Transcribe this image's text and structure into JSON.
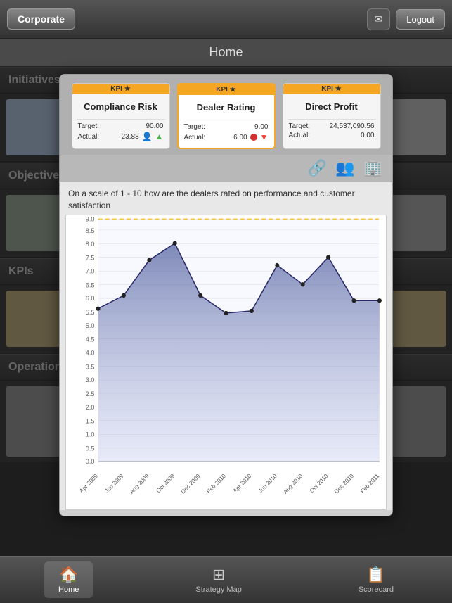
{
  "topBar": {
    "corpLabel": "Corporate",
    "mailIcon": "✉",
    "logoutLabel": "Logout"
  },
  "pageTitle": "Home",
  "sections": {
    "initiatives": "Initiatives",
    "objectives": "Objectives",
    "kpis": "KPIs",
    "operations": "Operations"
  },
  "modal": {
    "kpiCards": [
      {
        "id": "compliance",
        "header": "KPI ★",
        "title": "Compliance Risk",
        "targetLabel": "Target:",
        "targetValue": "90.00",
        "actualLabel": "Actual:",
        "actualValue": "23.88",
        "active": false
      },
      {
        "id": "dealer",
        "header": "KPI ★",
        "title": "Dealer Rating",
        "targetLabel": "Target:",
        "targetValue": "9.00",
        "actualLabel": "Actual:",
        "actualValue": "6.00",
        "active": true
      },
      {
        "id": "profit",
        "header": "KPI ★",
        "title": "Direct Profit",
        "targetLabel": "Target:",
        "targetValue": "24,537,090.56",
        "actualLabel": "Actual:",
        "actualValue": "0.00",
        "active": false
      }
    ],
    "icons": [
      "🔗",
      "👥",
      "🏢"
    ],
    "chartDescription": "On a scale of 1 - 10 how are the dealers rated on performance and customer satisfaction",
    "chart": {
      "targetLine": 9.0,
      "yMax": 9.0,
      "yMin": 0.0,
      "xLabels": [
        "Apr 2009",
        "Jun 2009",
        "Aug 2009",
        "Oct 2009",
        "Dec 2009",
        "Feb 2010",
        "Apr 2010",
        "Jun 2010",
        "Aug 2010",
        "Oct 2010",
        "Dec 2010",
        "Feb 2011"
      ],
      "dataPoints": [
        5.7,
        6.2,
        7.5,
        8.1,
        6.2,
        5.5,
        5.6,
        7.3,
        6.6,
        7.6,
        6.0,
        6.0
      ],
      "yTicks": [
        0.0,
        0.5,
        1.0,
        1.5,
        2.0,
        2.5,
        3.0,
        3.5,
        4.0,
        4.5,
        5.0,
        5.5,
        6.0,
        6.5,
        7.0,
        7.5,
        8.0,
        8.5,
        9.0
      ]
    }
  },
  "tabBar": {
    "tabs": [
      {
        "id": "home",
        "label": "Home",
        "icon": "🏠",
        "active": true
      },
      {
        "id": "strategy",
        "label": "Strategy Map",
        "icon": "⊞",
        "active": false
      },
      {
        "id": "scorecard",
        "label": "Scorecard",
        "icon": "📋",
        "active": false
      }
    ]
  }
}
